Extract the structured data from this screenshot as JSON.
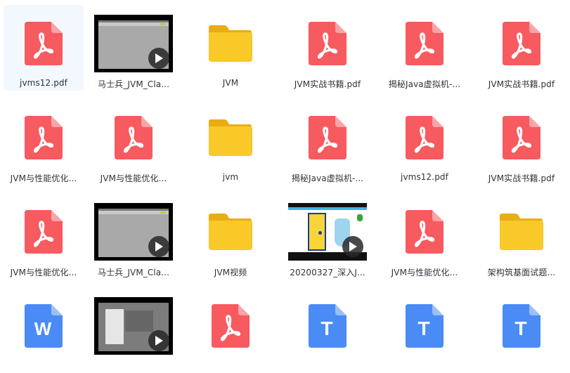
{
  "files": [
    {
      "name": "jvms12.pdf",
      "type": "pdf",
      "icon": "pdf-icon",
      "selected": true
    },
    {
      "name": "马士兵_JVM_Cla...",
      "type": "video",
      "icon": "video-thumbnail"
    },
    {
      "name": "JVM",
      "type": "folder",
      "icon": "folder-icon"
    },
    {
      "name": "JVM实战书籍.pdf",
      "type": "pdf",
      "icon": "pdf-icon"
    },
    {
      "name": "揭秘Java虚拟机-...",
      "type": "pdf",
      "icon": "pdf-icon"
    },
    {
      "name": "JVM实战书籍.pdf",
      "type": "pdf",
      "icon": "pdf-icon"
    },
    {
      "name": "JVM与性能优化...",
      "type": "pdf",
      "icon": "pdf-icon"
    },
    {
      "name": "JVM与性能优化...",
      "type": "pdf",
      "icon": "pdf-icon"
    },
    {
      "name": "jvm",
      "type": "folder",
      "icon": "folder-icon"
    },
    {
      "name": "揭秘Java虚拟机-...",
      "type": "pdf",
      "icon": "pdf-icon"
    },
    {
      "name": "jvms12.pdf",
      "type": "pdf",
      "icon": "pdf-icon"
    },
    {
      "name": "JVM实战书籍.pdf",
      "type": "pdf",
      "icon": "pdf-icon"
    },
    {
      "name": "JVM与性能优化...",
      "type": "pdf",
      "icon": "pdf-icon"
    },
    {
      "name": "马士兵_JVM_Cla...",
      "type": "video",
      "icon": "video-thumbnail"
    },
    {
      "name": "JVM视频",
      "type": "folder",
      "icon": "folder-icon"
    },
    {
      "name": "20200327_深入J...",
      "type": "video-cartoon",
      "icon": "video-thumbnail"
    },
    {
      "name": "JVM与性能优化...",
      "type": "pdf",
      "icon": "pdf-icon"
    },
    {
      "name": "架构筑基面试题...",
      "type": "folder",
      "icon": "folder-icon"
    },
    {
      "name": "",
      "type": "word",
      "icon": "word-doc-icon"
    },
    {
      "name": "",
      "type": "video-dark",
      "icon": "video-thumbnail"
    },
    {
      "name": "",
      "type": "pdf",
      "icon": "pdf-icon"
    },
    {
      "name": "",
      "type": "txt",
      "icon": "text-doc-icon"
    },
    {
      "name": "",
      "type": "txt",
      "icon": "text-doc-icon"
    },
    {
      "name": "",
      "type": "txt",
      "icon": "text-doc-icon"
    }
  ],
  "colors": {
    "pdf": "#f75a5f",
    "folder": "#f8c928",
    "folder_tab": "#e9ad13",
    "word": "#4a8bf5",
    "txt": "#4a8bf5",
    "selected_bg": "#f2f8fe"
  }
}
